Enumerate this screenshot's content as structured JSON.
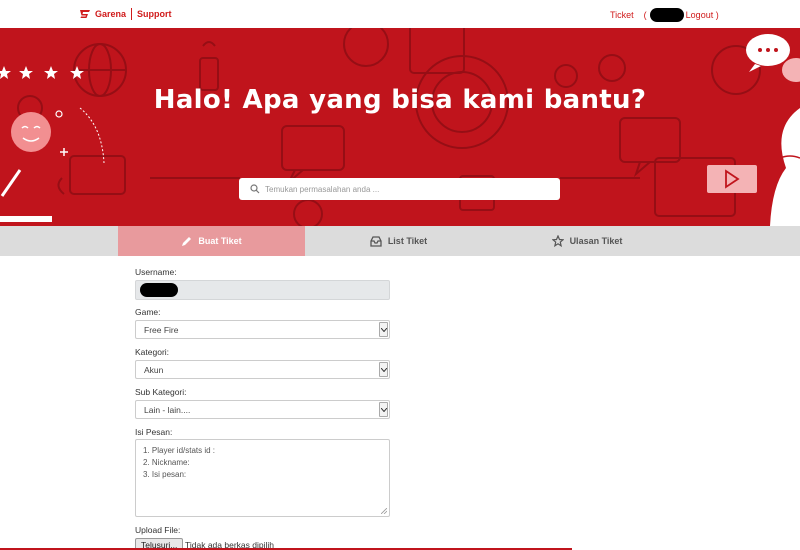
{
  "brand": {
    "name": "Garena",
    "section": "Support",
    "accent": "#c0141c"
  },
  "topnav": {
    "ticket": "Ticket",
    "open_paren": "(",
    "logout": "Logout )"
  },
  "hero": {
    "title": "Halo! Apa yang bisa kami bantu?",
    "search_placeholder": "Temukan permasalahan anda ...",
    "search_icon": "search-icon"
  },
  "tabs": [
    {
      "label": "Buat Tiket",
      "icon": "pencil-icon",
      "active": true
    },
    {
      "label": "List Tiket",
      "icon": "inbox-icon",
      "active": false
    },
    {
      "label": "Ulasan Tiket",
      "icon": "star-icon",
      "active": false
    }
  ],
  "form": {
    "username": {
      "label": "Username:",
      "value": ""
    },
    "game": {
      "label": "Game:",
      "value": "Free Fire"
    },
    "kategori": {
      "label": "Kategori:",
      "value": "Akun"
    },
    "sub_kategori": {
      "label": "Sub Kategori:",
      "value": "Lain - lain...."
    },
    "isi_pesan": {
      "label": "Isi Pesan:",
      "lines": [
        "1. Player id/stats id :",
        "2. Nickname:",
        "3. Isi pesan:"
      ]
    },
    "upload": {
      "label": "Upload File:",
      "button": "Telusuri...",
      "status": "Tidak ada berkas dipilih"
    }
  }
}
